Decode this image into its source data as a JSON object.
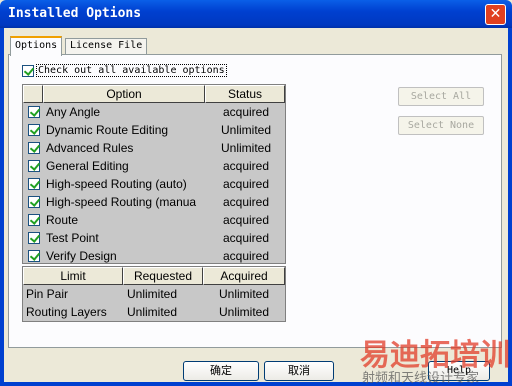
{
  "window": {
    "title": "Installed Options",
    "close_glyph": "✕"
  },
  "tabs": [
    {
      "label": "Options",
      "active": true
    },
    {
      "label": "License File",
      "active": false
    }
  ],
  "check_all": {
    "label": "Check out all available options",
    "checked": true
  },
  "options_table": {
    "headers": {
      "option": "Option",
      "status": "Status"
    },
    "rows": [
      {
        "name": "Any Angle",
        "status": "acquired",
        "checked": true
      },
      {
        "name": "Dynamic Route Editing",
        "status": "Unlimited",
        "checked": true
      },
      {
        "name": "Advanced Rules",
        "status": "Unlimited",
        "checked": true
      },
      {
        "name": "General Editing",
        "status": "acquired",
        "checked": true
      },
      {
        "name": "High-speed Routing (auto)",
        "status": "acquired",
        "checked": true
      },
      {
        "name": "High-speed Routing (manua",
        "status": "acquired",
        "checked": true
      },
      {
        "name": "Route",
        "status": "acquired",
        "checked": true
      },
      {
        "name": "Test Point",
        "status": "acquired",
        "checked": true
      },
      {
        "name": "Verify Design",
        "status": "acquired",
        "checked": true
      }
    ]
  },
  "limits_table": {
    "headers": {
      "limit": "Limit",
      "requested": "Requested",
      "acquired": "Acquired"
    },
    "rows": [
      {
        "limit": "Pin Pair",
        "requested": "Unlimited",
        "acquired": "Unlimited"
      },
      {
        "limit": "Routing Layers",
        "requested": "Unlimited",
        "acquired": "Unlimited"
      }
    ]
  },
  "side_buttons": {
    "select_all": "Select All",
    "select_none": "Select None"
  },
  "buttons": {
    "ok": "确定",
    "cancel": "取消",
    "help": "Help"
  },
  "watermark": {
    "main": "易迪拓培训",
    "sub": "射频和天线设计专家"
  },
  "colors": {
    "titlebar": "#0040d0",
    "dialog_bg": "#ece9d8",
    "list_bg": "#c8c8c8",
    "watermark": "#e13c28"
  }
}
